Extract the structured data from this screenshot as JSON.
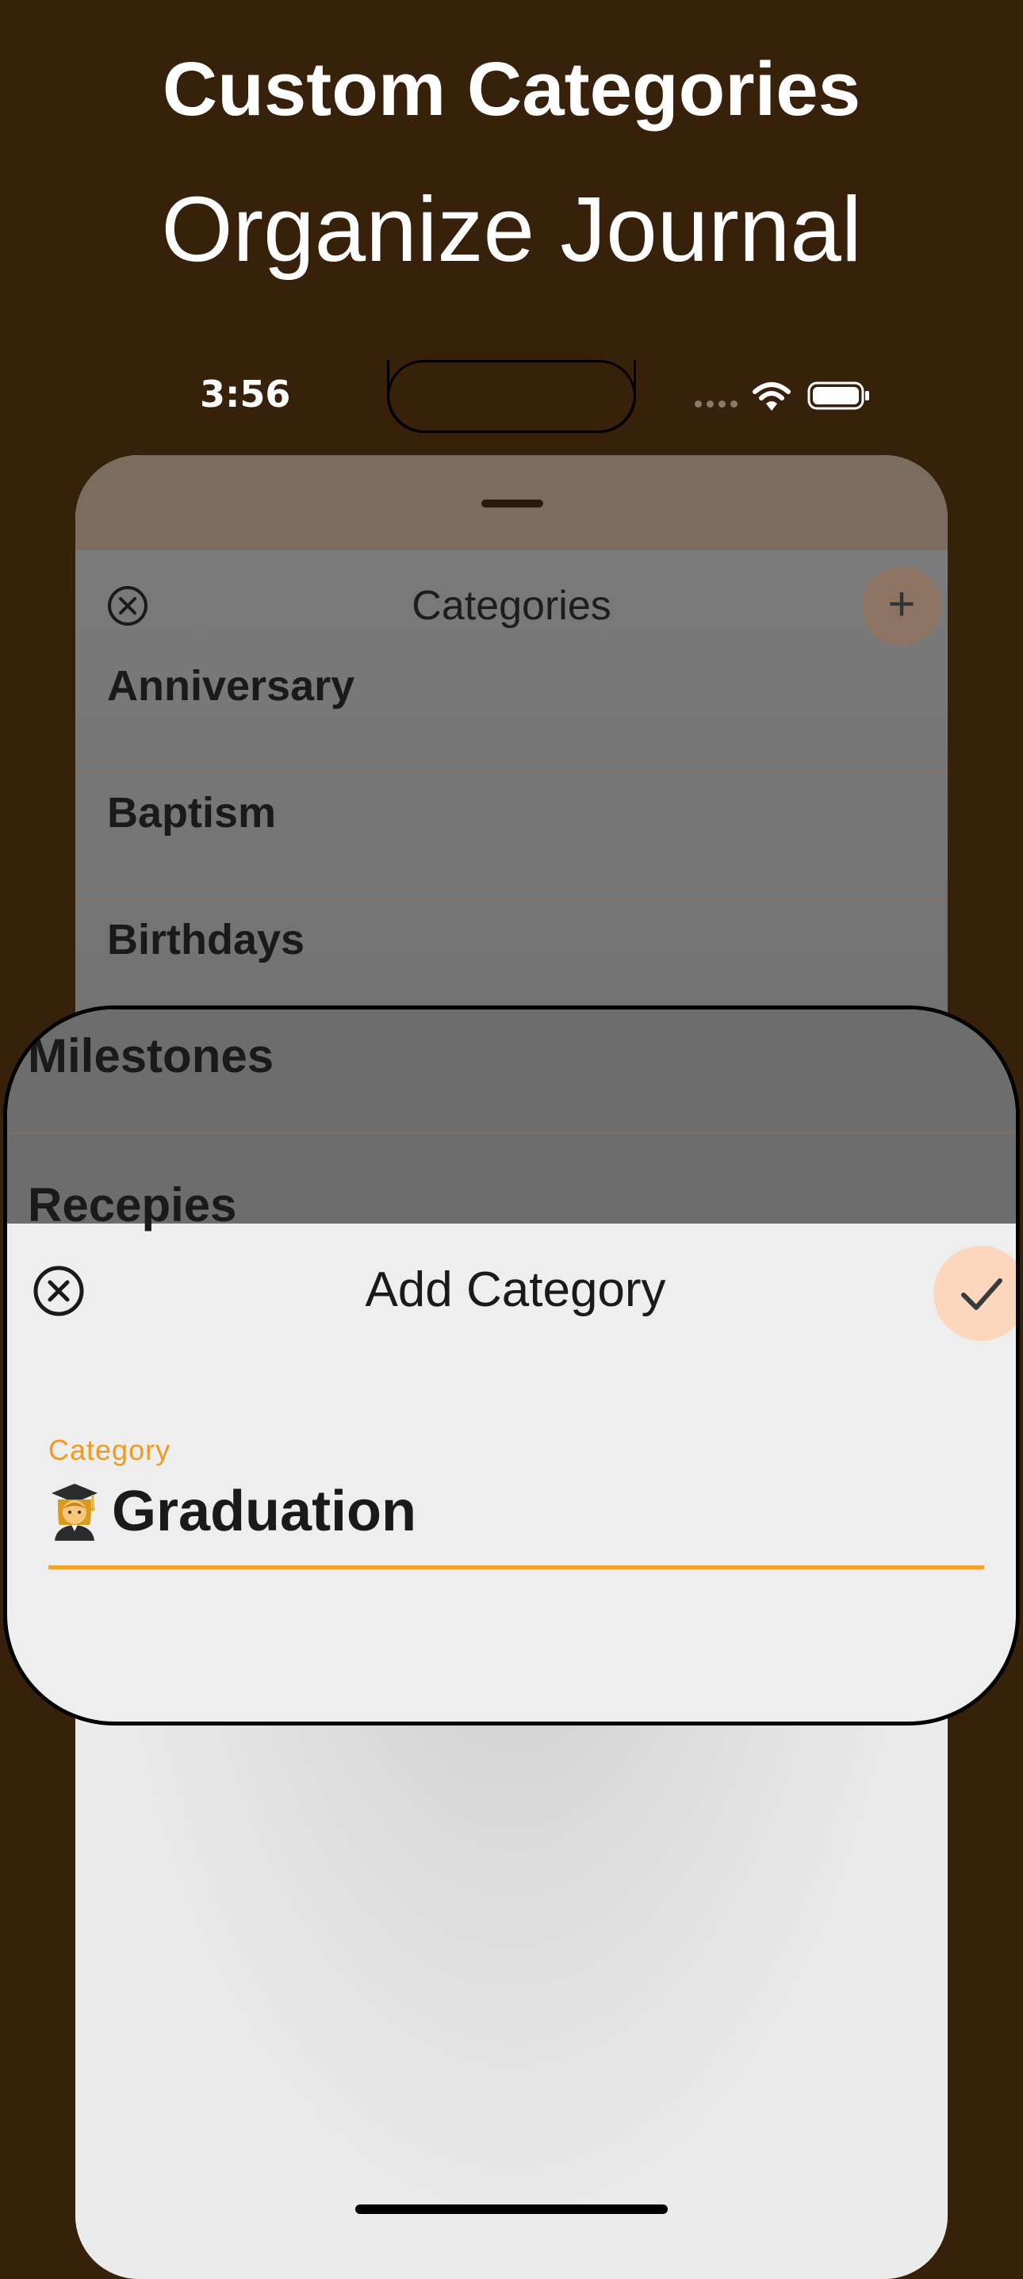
{
  "promo": {
    "title": "Custom Categories",
    "subtitle": "Organize Journal"
  },
  "status_bar": {
    "time": "3:56",
    "icons": [
      "cellular-signal-icon",
      "wifi-icon",
      "battery-icon"
    ]
  },
  "categories_sheet": {
    "title": "Categories",
    "close_icon": "close-circle-icon",
    "add_icon": "plus-icon",
    "items": [
      "Anniversary",
      "Baptism",
      "Birthdays",
      "Milestones",
      "Recepies"
    ]
  },
  "add_category_sheet": {
    "title": "Add Category",
    "close_icon": "close-circle-icon",
    "confirm_icon": "checkmark-icon",
    "field": {
      "label": "Category",
      "value_emoji": "graduate-emoji-icon",
      "value": "Graduation"
    }
  },
  "colors": {
    "background": "#37210A",
    "accent": "#F0A22A",
    "confirm_button": "#FCD7BD"
  }
}
